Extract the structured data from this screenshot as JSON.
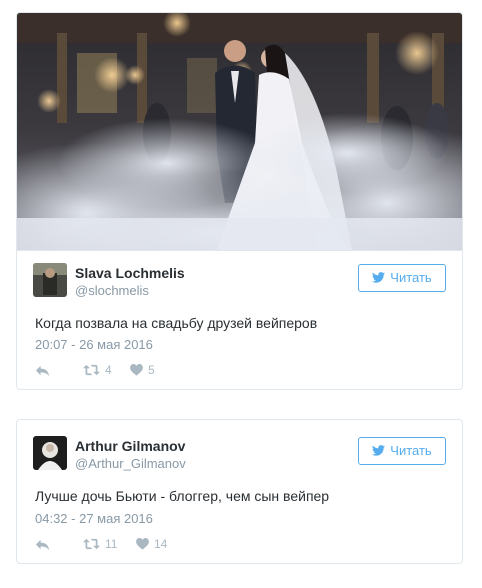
{
  "colors": {
    "twitter_blue": "#55acee",
    "text_dark": "#292f33",
    "text_muted": "#8899a6",
    "icon_gray": "#aab8c2",
    "border": "#e1e8ed"
  },
  "tweets": [
    {
      "name": "Slava Lochmelis",
      "handle": "@slochmelis",
      "follow_label": "Читать",
      "text": "Когда позвала на свадьбу друзей вейперов",
      "time": "20:07 - 26 мая 2016",
      "retweets": "4",
      "likes": "5",
      "icons": [
        "reply-icon",
        "retweet-icon",
        "heart-icon",
        "twitter-bird-icon"
      ]
    },
    {
      "name": "Arthur Gilmanov",
      "handle": "@Arthur_Gilmanov",
      "follow_label": "Читать",
      "text": "Лучше дочь Бьюти - блоггер, чем сын вейпер",
      "time": "04:32 - 27 мая 2016",
      "retweets": "11",
      "likes": "14",
      "icons": [
        "reply-icon",
        "retweet-icon",
        "heart-icon",
        "twitter-bird-icon"
      ]
    }
  ]
}
